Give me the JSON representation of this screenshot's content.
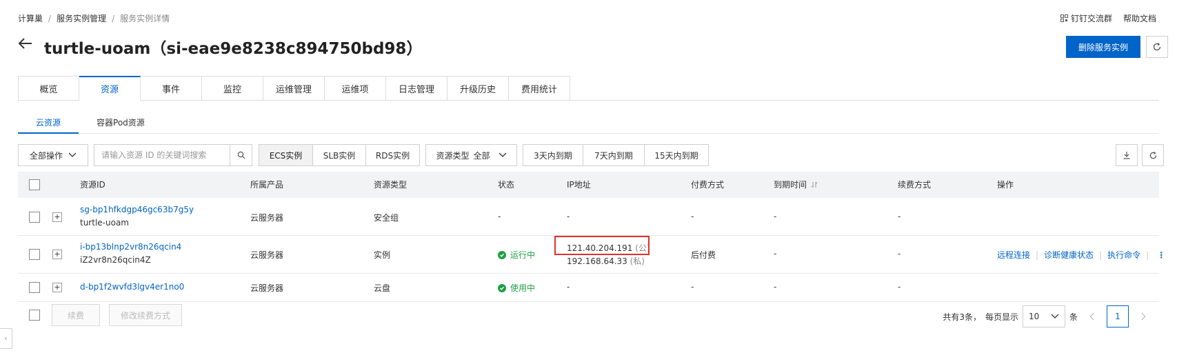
{
  "breadcrumb": [
    "计算巢",
    "服务实例管理",
    "服务实例详情"
  ],
  "top_links": {
    "dingtalk": "钉钉交流群",
    "help": "帮助文档"
  },
  "title": "turtle-uoam（si-eae9e8238c894750bd98）",
  "actions": {
    "delete": "删除服务实例"
  },
  "tabs": [
    "概览",
    "资源",
    "事件",
    "监控",
    "运维管理",
    "运维项",
    "日志管理",
    "升级历史",
    "费用统计"
  ],
  "active_tab": "资源",
  "subtabs": [
    "云资源",
    "容器Pod资源"
  ],
  "toolbar": {
    "all_ops": "全部操作",
    "search_placeholder": "请输入资源 ID 的关键词搜索",
    "instance_filters": [
      "ECS实例",
      "SLB实例",
      "RDS实例"
    ],
    "resource_type_label": "资源类型",
    "resource_type_value": "全部",
    "expiry_filters": [
      "3天内到期",
      "7天内到期",
      "15天内到期"
    ]
  },
  "table": {
    "headers": [
      "资源ID",
      "所属产品",
      "资源类型",
      "状态",
      "IP地址",
      "付费方式",
      "到期时间",
      "续费方式",
      "操作"
    ],
    "rows": [
      {
        "id": "sg-bp1hfkdgp46gc63b7g5y",
        "name": "turtle-uoam",
        "product": "云服务器",
        "type": "安全组",
        "status": "-",
        "ip1": "-",
        "ip1_tag": "",
        "ip2": "",
        "ip2_tag": "",
        "pay": "-",
        "expire": "-",
        "renew": "-"
      },
      {
        "id": "i-bp13blnp2vr8n26qcin4",
        "name": "iZ2vr8n26qcin4Z",
        "product": "云服务器",
        "type": "实例",
        "status": "运行中",
        "ip1": "121.40.204.191",
        "ip1_tag": "(公)",
        "ip2": "192.168.64.33",
        "ip2_tag": "(私)",
        "pay": "后付费",
        "expire": "-",
        "renew": "-"
      },
      {
        "id": "d-bp1f2wvfd3lgv4er1no0",
        "name": "",
        "product": "云服务器",
        "type": "云盘",
        "status": "使用中",
        "ip1": "-",
        "ip1_tag": "",
        "ip2": "",
        "ip2_tag": "",
        "pay": "-",
        "expire": "-",
        "renew": "-"
      }
    ],
    "row_ops": [
      "远程连接",
      "诊断健康状态",
      "执行命令"
    ]
  },
  "footer": {
    "renew": "续费",
    "modify_renew": "修改续费方式",
    "total": "共有3条，",
    "per_page_label": "每页显示",
    "per_page": "10",
    "unit": "条",
    "page": "1"
  },
  "colors": {
    "primary": "#0064c8",
    "success": "#1e9f45",
    "highlight": "#e0302d"
  }
}
